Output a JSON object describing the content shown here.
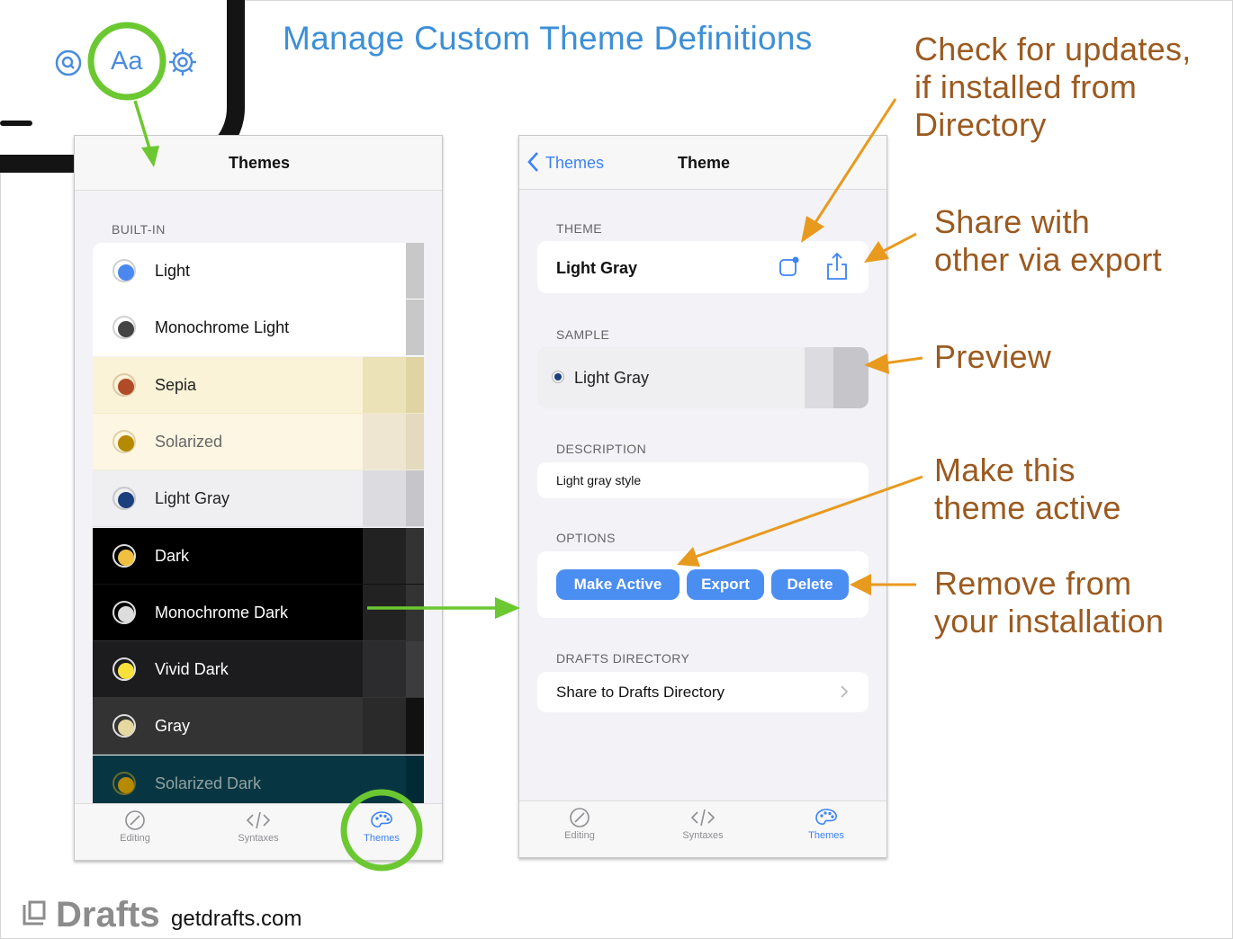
{
  "headline": "Manage Custom Theme Definitions",
  "corner": {
    "font_glyph": "Aa"
  },
  "annotations": {
    "updates": [
      "Check for updates,",
      "if installed from",
      "Directory"
    ],
    "share": [
      "Share with",
      "other via export"
    ],
    "preview": [
      "Preview"
    ],
    "make_active": [
      "Make this",
      "theme active"
    ],
    "remove": [
      "Remove from",
      "your installation"
    ]
  },
  "themes_screen": {
    "title": "Themes",
    "section": "BUILT-IN",
    "items": [
      {
        "label": "Light",
        "bg": "#ffffff",
        "text": "#111111",
        "dot": "#4a88f0",
        "ring": "#d0d0d0",
        "sw1": "#ffffff",
        "sw2": "#c8c8c8",
        "sep": "#ffffff"
      },
      {
        "label": "Monochrome Light",
        "bg": "#ffffff",
        "text": "#111111",
        "dot": "#444444",
        "ring": "#d0d0d0",
        "sw1": "#ffffff",
        "sw2": "#c8c8c8",
        "sep": "#ffffff"
      },
      {
        "label": "Sepia",
        "bg": "#fbf3d7",
        "text": "#222222",
        "dot": "#b04b28",
        "ring": "#dcc9a8",
        "sw1": "#ece2b8",
        "sw2": "#e0d3a4",
        "sep": "#f3e9c6"
      },
      {
        "label": "Solarized",
        "bg": "#fdf6e3",
        "text": "#666666",
        "dot": "#b58900",
        "ring": "#dfd3ab",
        "sw1": "#eee6d0",
        "sw2": "#e3dac0",
        "sep": "#f3ecd8"
      },
      {
        "label": "Light Gray",
        "bg": "#efeff1",
        "text": "#222222",
        "dot": "#1b3f7c",
        "ring": "#c8c8cc",
        "sw1": "#dcdce0",
        "sw2": "#c6c6ca",
        "sep": "#e2e2e5"
      },
      {
        "label": "Dark",
        "bg": "#000000",
        "text": "#ffffff",
        "dot": "#f0c040",
        "ring": "#dddddd",
        "sw1": "#222222",
        "sw2": "#333333",
        "sep": "#111111"
      },
      {
        "label": "Monochrome Dark",
        "bg": "#000000",
        "text": "#ffffff",
        "dot": "#dddddd",
        "ring": "#dddddd",
        "sw1": "#222222",
        "sw2": "#333333",
        "sep": "#333333"
      },
      {
        "label": "Vivid Dark",
        "bg": "#1c1c1e",
        "text": "#ffffff",
        "dot": "#f7e03a",
        "ring": "#dddddd",
        "sw1": "#2c2c2e",
        "sw2": "#3c3c3e",
        "sep": "#333333"
      },
      {
        "label": "Gray",
        "bg": "#333333",
        "text": "#ffffff",
        "dot": "#e5d8a0",
        "ring": "#dddddd",
        "sw1": "#2a2a2a",
        "sw2": "#111111",
        "sep": "#444444"
      },
      {
        "label": "Solarized Dark",
        "bg": "#073642",
        "text": "#93a1a1",
        "dot": "#b58900",
        "ring": "#6b6b2a",
        "sw1": "#073642",
        "sw2": "#002b36",
        "sep": "#0a4050"
      }
    ],
    "tabs": [
      {
        "label": "Editing",
        "icon": "compass-icon"
      },
      {
        "label": "Syntaxes",
        "icon": "code-icon"
      },
      {
        "label": "Themes",
        "icon": "palette-icon"
      }
    ]
  },
  "theme_screen": {
    "back_label": "Themes",
    "title": "Theme",
    "theme_section": "THEME",
    "theme_name": "Light Gray",
    "sample_section": "SAMPLE",
    "sample_label": "Light Gray",
    "description_section": "DESCRIPTION",
    "description": "Light gray style",
    "options_section": "OPTIONS",
    "buttons": {
      "make_active": "Make Active",
      "export": "Export",
      "delete": "Delete"
    },
    "directory_section": "DRAFTS DIRECTORY",
    "directory_link": "Share to Drafts Directory",
    "tabs": [
      {
        "label": "Editing",
        "icon": "compass-icon"
      },
      {
        "label": "Syntaxes",
        "icon": "code-icon"
      },
      {
        "label": "Themes",
        "icon": "palette-icon"
      }
    ]
  },
  "footer": {
    "logo": "Drafts",
    "url": "getdrafts.com"
  },
  "colors": {
    "accent_blue": "#3d8fd6",
    "highlight_green": "#6cc831",
    "annotation_orange": "#e89a1f",
    "annotation_text": "#9b5a20",
    "button_blue": "#4b8ef1"
  }
}
